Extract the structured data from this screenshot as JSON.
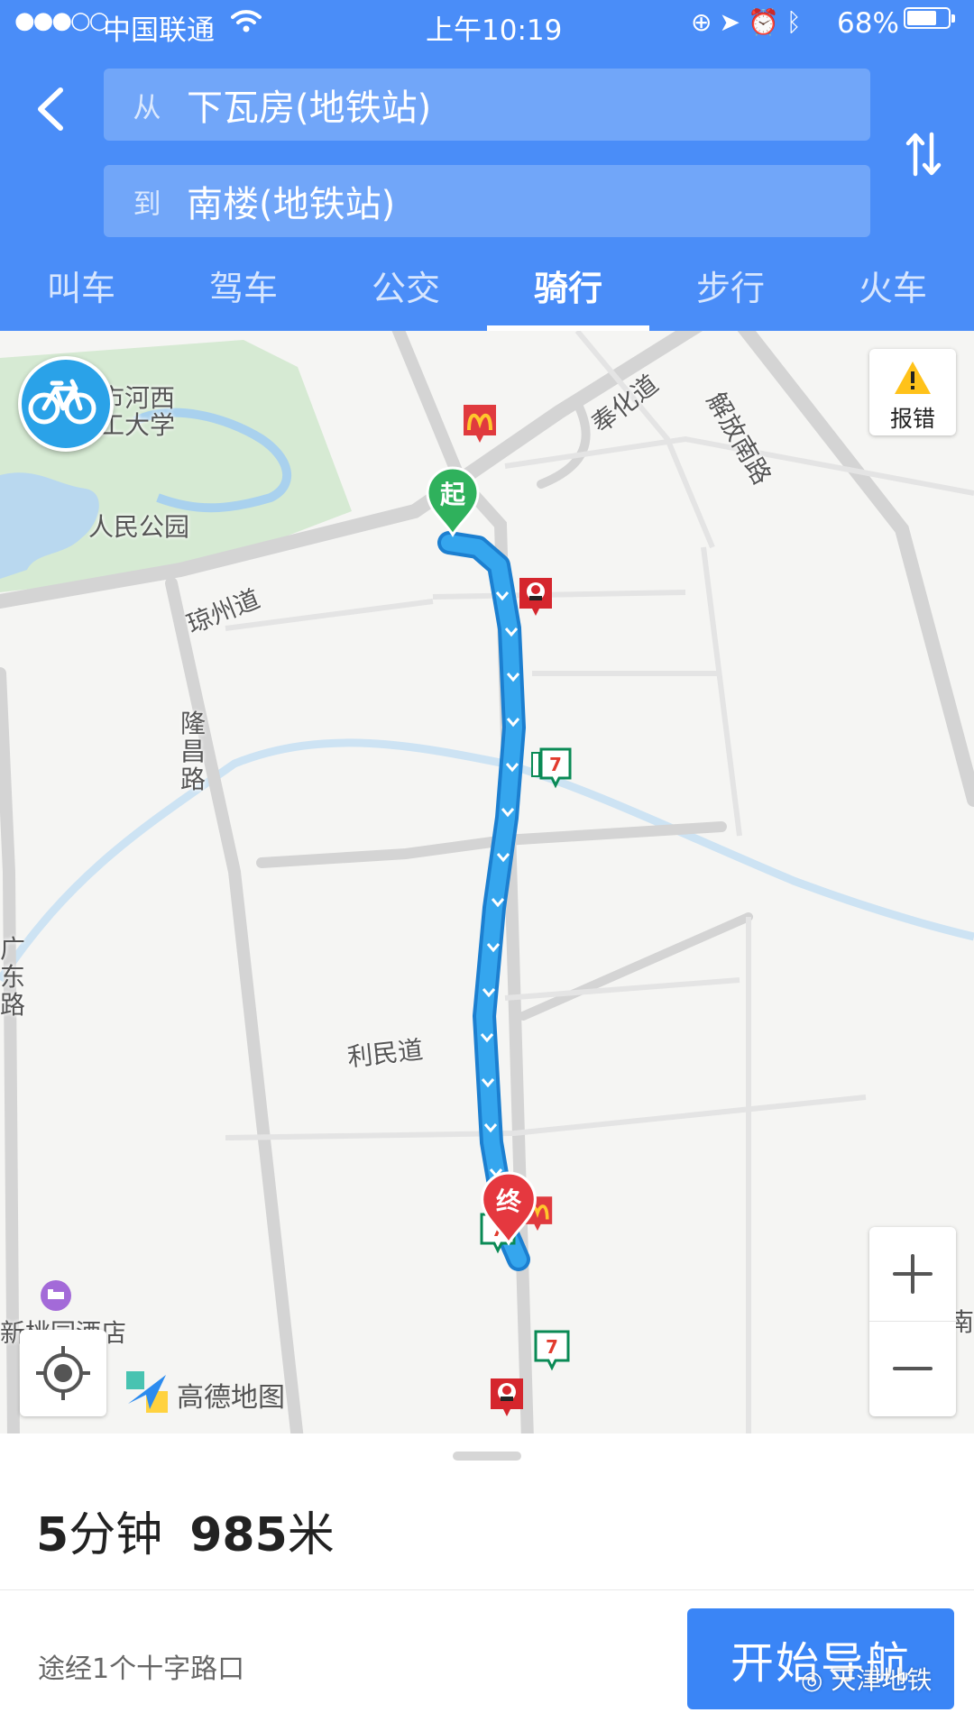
{
  "status_bar": {
    "signal": "●●●○○",
    "carrier": "中国联通",
    "time": "上午10:19",
    "battery_pct": "68%"
  },
  "route": {
    "from_prefix": "从",
    "from": "下瓦房(地铁站)",
    "to_prefix": "到",
    "to": "南楼(地铁站)"
  },
  "tabs": [
    {
      "label": "叫车"
    },
    {
      "label": "驾车"
    },
    {
      "label": "公交"
    },
    {
      "label": "骑行",
      "active": true
    },
    {
      "label": "步行"
    },
    {
      "label": "火车"
    }
  ],
  "map": {
    "labels": {
      "university": "市河西\n工大学",
      "park": "人民公园",
      "qiongzhou": "琼州道",
      "fenghua": "奉化道",
      "jiefang": "解放南路",
      "longchang": "隆\n昌\n路",
      "limin": "利民道",
      "guangdong": "广\n东\n路",
      "hotel": "新桃园酒店",
      "edge_south": "南"
    },
    "start_marker": "起",
    "end_marker": "终",
    "report_label": "报错",
    "logo_text": "高德地图",
    "zoom_in": "+",
    "zoom_out": "−"
  },
  "summary": {
    "minutes": "5",
    "minutes_unit": "分钟",
    "distance": "985",
    "distance_unit": "米",
    "via": "途经1个十字路口"
  },
  "actions": {
    "start_navigation": "开始导航"
  },
  "watermark": "天津地铁",
  "colors": {
    "header_blue": "#4a8df8",
    "route_blue": "#2b9ae8",
    "start_green": "#2fb15c",
    "end_red": "#e5383f",
    "button_blue": "#3a85f6"
  }
}
